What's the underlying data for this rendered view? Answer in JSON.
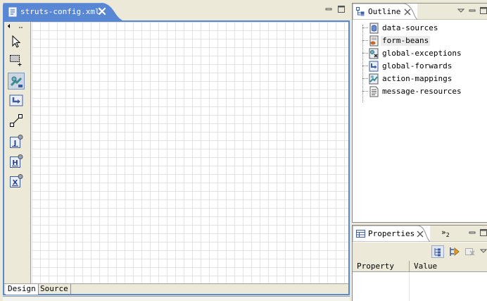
{
  "editor": {
    "tab_label": "struts-config.xml",
    "bottom_tabs": [
      {
        "label": "Design",
        "active": true
      },
      {
        "label": "Source",
        "active": false
      }
    ]
  },
  "palette": {
    "tools": [
      {
        "icon": "select-arrow-icon"
      },
      {
        "icon": "marquee-select-icon"
      },
      {
        "icon": "action-icon",
        "selected": true
      },
      {
        "icon": "forward-icon"
      },
      {
        "icon": "connection-icon"
      },
      {
        "icon": "jsp-page-icon",
        "letter": "J"
      },
      {
        "icon": "html-page-icon",
        "letter": "H"
      },
      {
        "icon": "xhtml-page-icon",
        "letter": "X"
      }
    ]
  },
  "outline": {
    "title": "Outline",
    "items": [
      {
        "label": "data-sources",
        "icon": "data-sources-icon"
      },
      {
        "label": "form-beans",
        "icon": "form-beans-icon",
        "selected": true
      },
      {
        "label": "global-exceptions",
        "icon": "global-exceptions-icon"
      },
      {
        "label": "global-forwards",
        "icon": "global-forwards-icon"
      },
      {
        "label": "action-mappings",
        "icon": "action-mappings-icon"
      },
      {
        "label": "message-resources",
        "icon": "message-resources-icon"
      }
    ]
  },
  "properties": {
    "title": "Properties",
    "overflow": "»",
    "overflow_count": "2",
    "columns": [
      "Property",
      "Value"
    ]
  },
  "colors": {
    "active_tab": "#5887d4",
    "panel_bg": "#ece9d8",
    "grid_line": "#e3e3e3"
  }
}
